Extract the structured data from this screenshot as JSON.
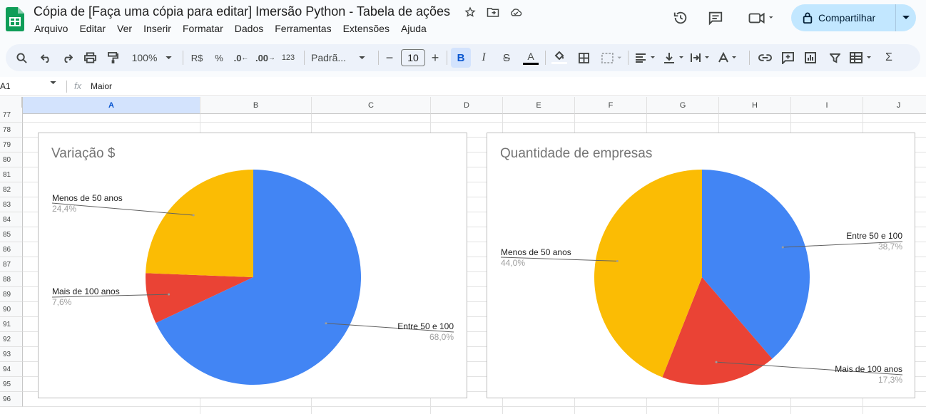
{
  "document": {
    "title": "Cópia de [Faça uma cópia para editar] Imersão Python - Tabela de ações"
  },
  "menu": [
    "Arquivo",
    "Editar",
    "Ver",
    "Inserir",
    "Formatar",
    "Dados",
    "Ferramentas",
    "Extensões",
    "Ajuda"
  ],
  "share": {
    "label": "Compartilhar"
  },
  "toolbar": {
    "zoom": "100%",
    "currency": "R$",
    "percent": "%",
    "decrease_decimals": ".0",
    "increase_decimals": ".00",
    "number_format": "123",
    "font_name": "Padrã...",
    "font_size": "10"
  },
  "formula_bar": {
    "cell_ref": "A1",
    "fx": "fx",
    "content": "Maior"
  },
  "columns": [
    "A",
    "B",
    "C",
    "D",
    "E",
    "F",
    "G",
    "H",
    "I",
    "J"
  ],
  "rows": [
    "77",
    "78",
    "79",
    "80",
    "81",
    "82",
    "83",
    "84",
    "85",
    "86",
    "87",
    "88",
    "89",
    "90",
    "91",
    "92",
    "93",
    "94",
    "95",
    "96"
  ],
  "colors": {
    "blue": "#4285f4",
    "red": "#ea4335",
    "yellow": "#fbbc04",
    "share_bg": "#c2e7ff",
    "toolbar_bg": "#edf2fa"
  },
  "chart_data": [
    {
      "type": "pie",
      "title": "Variação $",
      "slices": [
        {
          "label": "Entre 50 e 100",
          "value": 68.0,
          "pct_text": "68,0%",
          "color": "#4285f4"
        },
        {
          "label": "Mais de 100 anos",
          "value": 7.6,
          "pct_text": "7,6%",
          "color": "#ea4335"
        },
        {
          "label": "Menos de 50 anos",
          "value": 24.4,
          "pct_text": "24,4%",
          "color": "#fbbc04"
        }
      ]
    },
    {
      "type": "pie",
      "title": "Quantidade de empresas",
      "slices": [
        {
          "label": "Entre 50 e 100",
          "value": 38.7,
          "pct_text": "38,7%",
          "color": "#4285f4"
        },
        {
          "label": "Mais de 100 anos",
          "value": 17.3,
          "pct_text": "17,3%",
          "color": "#ea4335"
        },
        {
          "label": "Menos de 50 anos",
          "value": 44.0,
          "pct_text": "44,0%",
          "color": "#fbbc04"
        }
      ]
    }
  ]
}
